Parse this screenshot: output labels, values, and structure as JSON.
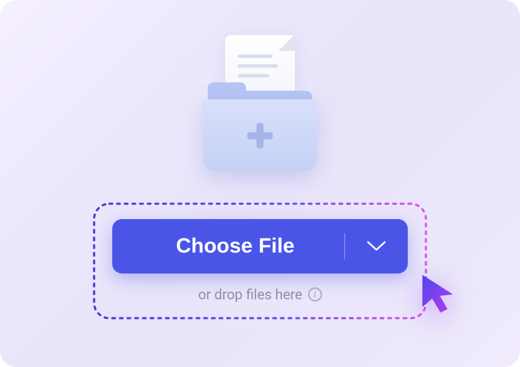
{
  "upload": {
    "choose_label": "Choose File",
    "drop_hint": "or drop files here"
  },
  "colors": {
    "button_bg": "#4a55e8",
    "hint_text": "#8890a8"
  }
}
